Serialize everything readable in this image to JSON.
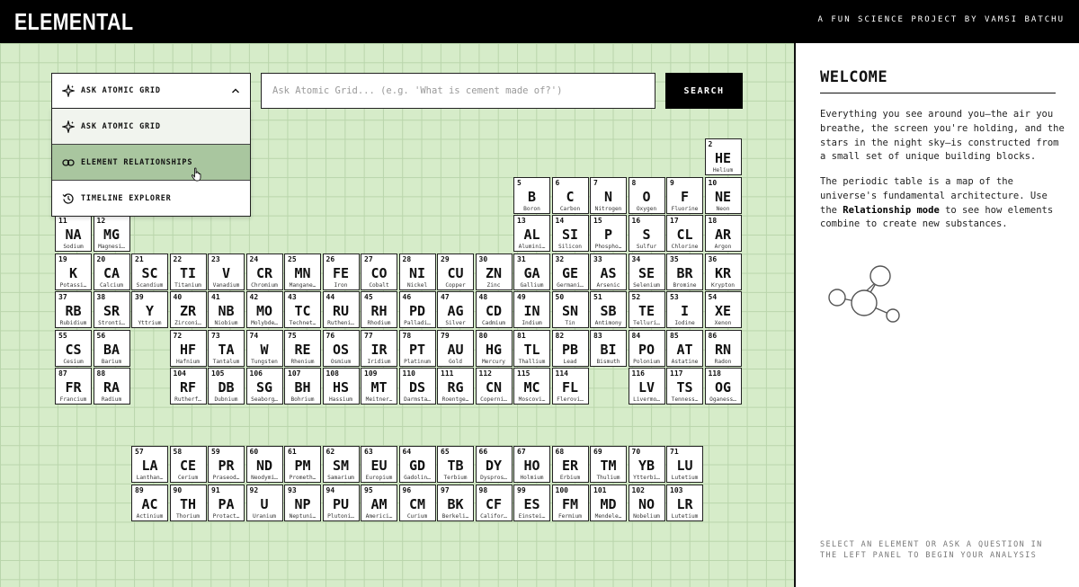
{
  "header": {
    "brand": "ELEMENTAL",
    "credit": "A FUN SCIENCE PROJECT BY VAMSI BATCHU"
  },
  "controls": {
    "selected_mode": "ASK ATOMIC GRID",
    "modes": [
      "ASK ATOMIC GRID",
      "ELEMENT RELATIONSHIPS",
      "TIMELINE EXPLORER"
    ],
    "hovered_mode_index": 1,
    "search_placeholder": "Ask Atomic Grid... (e.g. 'What is cement made of?')",
    "search_button": "SEARCH"
  },
  "sidebar": {
    "title": "WELCOME",
    "para1": "Everything you see around you—the air you breathe, the screen you're holding, and the stars in the night sky—is constructed from a small set of unique building blocks.",
    "para2_before": "The periodic table is a map of the universe's fundamental architecture. Use the ",
    "para2_bold": "Relationship mode",
    "para2_after": " to see how elements combine to create new substances.",
    "hint": "SELECT AN ELEMENT OR ASK A QUESTION IN THE LEFT PANEL TO BEGIN YOUR ANALYSIS"
  },
  "elements": [
    {
      "n": "2",
      "s": "HE",
      "name": "Helium",
      "r": 1,
      "c": 18
    },
    {
      "n": "5",
      "s": "B",
      "name": "Boron",
      "r": 2,
      "c": 13
    },
    {
      "n": "6",
      "s": "C",
      "name": "Carbon",
      "r": 2,
      "c": 14
    },
    {
      "n": "7",
      "s": "N",
      "name": "Nitrogen",
      "r": 2,
      "c": 15
    },
    {
      "n": "8",
      "s": "O",
      "name": "Oxygen",
      "r": 2,
      "c": 16
    },
    {
      "n": "9",
      "s": "F",
      "name": "Fluorine",
      "r": 2,
      "c": 17
    },
    {
      "n": "10",
      "s": "NE",
      "name": "Neon",
      "r": 2,
      "c": 18
    },
    {
      "n": "11",
      "s": "NA",
      "name": "Sodium",
      "r": 3,
      "c": 1
    },
    {
      "n": "12",
      "s": "MG",
      "name": "Magnesi…",
      "r": 3,
      "c": 2
    },
    {
      "n": "13",
      "s": "AL",
      "name": "Alumini…",
      "r": 3,
      "c": 13
    },
    {
      "n": "14",
      "s": "SI",
      "name": "Silicon",
      "r": 3,
      "c": 14
    },
    {
      "n": "15",
      "s": "P",
      "name": "Phospho…",
      "r": 3,
      "c": 15
    },
    {
      "n": "16",
      "s": "S",
      "name": "Sulfur",
      "r": 3,
      "c": 16
    },
    {
      "n": "17",
      "s": "CL",
      "name": "Chlorine",
      "r": 3,
      "c": 17
    },
    {
      "n": "18",
      "s": "AR",
      "name": "Argon",
      "r": 3,
      "c": 18
    },
    {
      "n": "19",
      "s": "K",
      "name": "Potassi…",
      "r": 4,
      "c": 1
    },
    {
      "n": "20",
      "s": "CA",
      "name": "Calcium",
      "r": 4,
      "c": 2
    },
    {
      "n": "21",
      "s": "SC",
      "name": "Scandium",
      "r": 4,
      "c": 3
    },
    {
      "n": "22",
      "s": "TI",
      "name": "Titanium",
      "r": 4,
      "c": 4
    },
    {
      "n": "23",
      "s": "V",
      "name": "Vanadium",
      "r": 4,
      "c": 5
    },
    {
      "n": "24",
      "s": "CR",
      "name": "Chromium",
      "r": 4,
      "c": 6
    },
    {
      "n": "25",
      "s": "MN",
      "name": "Mangane…",
      "r": 4,
      "c": 7
    },
    {
      "n": "26",
      "s": "FE",
      "name": "Iron",
      "r": 4,
      "c": 8
    },
    {
      "n": "27",
      "s": "CO",
      "name": "Cobalt",
      "r": 4,
      "c": 9
    },
    {
      "n": "28",
      "s": "NI",
      "name": "Nickel",
      "r": 4,
      "c": 10
    },
    {
      "n": "29",
      "s": "CU",
      "name": "Copper",
      "r": 4,
      "c": 11
    },
    {
      "n": "30",
      "s": "ZN",
      "name": "Zinc",
      "r": 4,
      "c": 12
    },
    {
      "n": "31",
      "s": "GA",
      "name": "Gallium",
      "r": 4,
      "c": 13
    },
    {
      "n": "32",
      "s": "GE",
      "name": "Germani…",
      "r": 4,
      "c": 14
    },
    {
      "n": "33",
      "s": "AS",
      "name": "Arsenic",
      "r": 4,
      "c": 15
    },
    {
      "n": "34",
      "s": "SE",
      "name": "Selenium",
      "r": 4,
      "c": 16
    },
    {
      "n": "35",
      "s": "BR",
      "name": "Bromine",
      "r": 4,
      "c": 17
    },
    {
      "n": "36",
      "s": "KR",
      "name": "Krypton",
      "r": 4,
      "c": 18
    },
    {
      "n": "37",
      "s": "RB",
      "name": "Rubidium",
      "r": 5,
      "c": 1
    },
    {
      "n": "38",
      "s": "SR",
      "name": "Stronti…",
      "r": 5,
      "c": 2
    },
    {
      "n": "39",
      "s": "Y",
      "name": "Yttrium",
      "r": 5,
      "c": 3
    },
    {
      "n": "40",
      "s": "ZR",
      "name": "Zirconi…",
      "r": 5,
      "c": 4
    },
    {
      "n": "41",
      "s": "NB",
      "name": "Niobium",
      "r": 5,
      "c": 5
    },
    {
      "n": "42",
      "s": "MO",
      "name": "Molybde…",
      "r": 5,
      "c": 6
    },
    {
      "n": "43",
      "s": "TC",
      "name": "Technet…",
      "r": 5,
      "c": 7
    },
    {
      "n": "44",
      "s": "RU",
      "name": "Rutheni…",
      "r": 5,
      "c": 8
    },
    {
      "n": "45",
      "s": "RH",
      "name": "Rhodium",
      "r": 5,
      "c": 9
    },
    {
      "n": "46",
      "s": "PD",
      "name": "Palladi…",
      "r": 5,
      "c": 10
    },
    {
      "n": "47",
      "s": "AG",
      "name": "Silver",
      "r": 5,
      "c": 11
    },
    {
      "n": "48",
      "s": "CD",
      "name": "Cadmium",
      "r": 5,
      "c": 12
    },
    {
      "n": "49",
      "s": "IN",
      "name": "Indium",
      "r": 5,
      "c": 13
    },
    {
      "n": "50",
      "s": "SN",
      "name": "Tin",
      "r": 5,
      "c": 14
    },
    {
      "n": "51",
      "s": "SB",
      "name": "Antimony",
      "r": 5,
      "c": 15
    },
    {
      "n": "52",
      "s": "TE",
      "name": "Telluri…",
      "r": 5,
      "c": 16
    },
    {
      "n": "53",
      "s": "I",
      "name": "Iodine",
      "r": 5,
      "c": 17
    },
    {
      "n": "54",
      "s": "XE",
      "name": "Xenon",
      "r": 5,
      "c": 18
    },
    {
      "n": "55",
      "s": "CS",
      "name": "Cesium",
      "r": 6,
      "c": 1
    },
    {
      "n": "56",
      "s": "BA",
      "name": "Barium",
      "r": 6,
      "c": 2
    },
    {
      "n": "72",
      "s": "HF",
      "name": "Hafnium",
      "r": 6,
      "c": 4
    },
    {
      "n": "73",
      "s": "TA",
      "name": "Tantalum",
      "r": 6,
      "c": 5
    },
    {
      "n": "74",
      "s": "W",
      "name": "Tungsten",
      "r": 6,
      "c": 6
    },
    {
      "n": "75",
      "s": "RE",
      "name": "Rhenium",
      "r": 6,
      "c": 7
    },
    {
      "n": "76",
      "s": "OS",
      "name": "Osmium",
      "r": 6,
      "c": 8
    },
    {
      "n": "77",
      "s": "IR",
      "name": "Iridium",
      "r": 6,
      "c": 9
    },
    {
      "n": "78",
      "s": "PT",
      "name": "Platinum",
      "r": 6,
      "c": 10
    },
    {
      "n": "79",
      "s": "AU",
      "name": "Gold",
      "r": 6,
      "c": 11
    },
    {
      "n": "80",
      "s": "HG",
      "name": "Mercury",
      "r": 6,
      "c": 12
    },
    {
      "n": "81",
      "s": "TL",
      "name": "Thallium",
      "r": 6,
      "c": 13
    },
    {
      "n": "82",
      "s": "PB",
      "name": "Lead",
      "r": 6,
      "c": 14
    },
    {
      "n": "83",
      "s": "BI",
      "name": "Bismuth",
      "r": 6,
      "c": 15
    },
    {
      "n": "84",
      "s": "PO",
      "name": "Polonium",
      "r": 6,
      "c": 16
    },
    {
      "n": "85",
      "s": "AT",
      "name": "Astatine",
      "r": 6,
      "c": 17
    },
    {
      "n": "86",
      "s": "RN",
      "name": "Radon",
      "r": 6,
      "c": 18
    },
    {
      "n": "87",
      "s": "FR",
      "name": "Francium",
      "r": 7,
      "c": 1
    },
    {
      "n": "88",
      "s": "RA",
      "name": "Radium",
      "r": 7,
      "c": 2
    },
    {
      "n": "104",
      "s": "RF",
      "name": "Rutherf…",
      "r": 7,
      "c": 4
    },
    {
      "n": "105",
      "s": "DB",
      "name": "Dubnium",
      "r": 7,
      "c": 5
    },
    {
      "n": "106",
      "s": "SG",
      "name": "Seaborg…",
      "r": 7,
      "c": 6
    },
    {
      "n": "107",
      "s": "BH",
      "name": "Bohrium",
      "r": 7,
      "c": 7
    },
    {
      "n": "108",
      "s": "HS",
      "name": "Hassium",
      "r": 7,
      "c": 8
    },
    {
      "n": "109",
      "s": "MT",
      "name": "Meitner…",
      "r": 7,
      "c": 9
    },
    {
      "n": "110",
      "s": "DS",
      "name": "Darmsta…",
      "r": 7,
      "c": 10
    },
    {
      "n": "111",
      "s": "RG",
      "name": "Roentge…",
      "r": 7,
      "c": 11
    },
    {
      "n": "112",
      "s": "CN",
      "name": "Coperni…",
      "r": 7,
      "c": 12
    },
    {
      "n": "115",
      "s": "MC",
      "name": "Moscovi…",
      "r": 7,
      "c": 13
    },
    {
      "n": "114",
      "s": "FL",
      "name": "Flerovi…",
      "r": 7,
      "c": 14
    },
    {
      "n": "116",
      "s": "LV",
      "name": "Livermo…",
      "r": 7,
      "c": 16
    },
    {
      "n": "117",
      "s": "TS",
      "name": "Tenness…",
      "r": 7,
      "c": 17
    },
    {
      "n": "118",
      "s": "OG",
      "name": "Oganess…",
      "r": 7,
      "c": 18
    },
    {
      "n": "57",
      "s": "LA",
      "name": "Lanthan…",
      "r": 9,
      "c": 3
    },
    {
      "n": "58",
      "s": "CE",
      "name": "Cerium",
      "r": 9,
      "c": 4
    },
    {
      "n": "59",
      "s": "PR",
      "name": "Praseod…",
      "r": 9,
      "c": 5
    },
    {
      "n": "60",
      "s": "ND",
      "name": "Neodymi…",
      "r": 9,
      "c": 6
    },
    {
      "n": "61",
      "s": "PM",
      "name": "Prometh…",
      "r": 9,
      "c": 7
    },
    {
      "n": "62",
      "s": "SM",
      "name": "Samarium",
      "r": 9,
      "c": 8
    },
    {
      "n": "63",
      "s": "EU",
      "name": "Europium",
      "r": 9,
      "c": 9
    },
    {
      "n": "64",
      "s": "GD",
      "name": "Gadolin…",
      "r": 9,
      "c": 10
    },
    {
      "n": "65",
      "s": "TB",
      "name": "Terbium",
      "r": 9,
      "c": 11
    },
    {
      "n": "66",
      "s": "DY",
      "name": "Dyspros…",
      "r": 9,
      "c": 12
    },
    {
      "n": "67",
      "s": "HO",
      "name": "Holmium",
      "r": 9,
      "c": 13
    },
    {
      "n": "68",
      "s": "ER",
      "name": "Erbium",
      "r": 9,
      "c": 14
    },
    {
      "n": "69",
      "s": "TM",
      "name": "Thulium",
      "r": 9,
      "c": 15
    },
    {
      "n": "70",
      "s": "YB",
      "name": "Ytterbi…",
      "r": 9,
      "c": 16
    },
    {
      "n": "71",
      "s": "LU",
      "name": "Lutetium",
      "r": 9,
      "c": 17
    },
    {
      "n": "89",
      "s": "AC",
      "name": "Actinium",
      "r": 10,
      "c": 3
    },
    {
      "n": "90",
      "s": "TH",
      "name": "Thorium",
      "r": 10,
      "c": 4
    },
    {
      "n": "91",
      "s": "PA",
      "name": "Protact…",
      "r": 10,
      "c": 5
    },
    {
      "n": "92",
      "s": "U",
      "name": "Uranium",
      "r": 10,
      "c": 6
    },
    {
      "n": "93",
      "s": "NP",
      "name": "Neptuni…",
      "r": 10,
      "c": 7
    },
    {
      "n": "94",
      "s": "PU",
      "name": "Plutoni…",
      "r": 10,
      "c": 8
    },
    {
      "n": "95",
      "s": "AM",
      "name": "Americi…",
      "r": 10,
      "c": 9
    },
    {
      "n": "96",
      "s": "CM",
      "name": "Curium",
      "r": 10,
      "c": 10
    },
    {
      "n": "97",
      "s": "BK",
      "name": "Berkeli…",
      "r": 10,
      "c": 11
    },
    {
      "n": "98",
      "s": "CF",
      "name": "Califor…",
      "r": 10,
      "c": 12
    },
    {
      "n": "99",
      "s": "ES",
      "name": "Einstei…",
      "r": 10,
      "c": 13
    },
    {
      "n": "100",
      "s": "FM",
      "name": "Fermium",
      "r": 10,
      "c": 14
    },
    {
      "n": "101",
      "s": "MD",
      "name": "Mendele…",
      "r": 10,
      "c": 15
    },
    {
      "n": "102",
      "s": "NO",
      "name": "Nobelium",
      "r": 10,
      "c": 16
    },
    {
      "n": "103",
      "s": "LR",
      "name": "Lutetium",
      "r": 10,
      "c": 17
    }
  ]
}
